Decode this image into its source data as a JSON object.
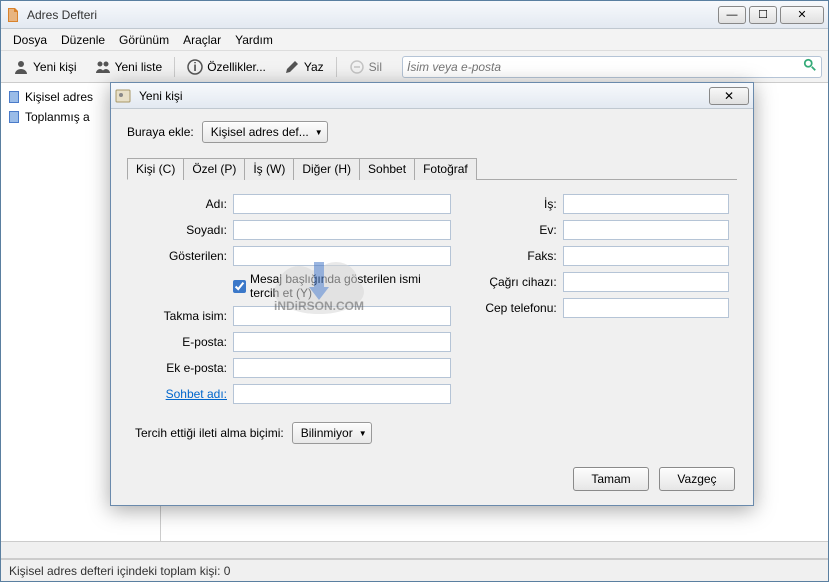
{
  "main": {
    "title": "Adres Defteri",
    "menu": {
      "file": "Dosya",
      "edit": "Düzenle",
      "view": "Görünüm",
      "tools": "Araçlar",
      "help": "Yardım"
    },
    "toolbar": {
      "new_contact": "Yeni kişi",
      "new_list": "Yeni liste",
      "properties": "Özellikler...",
      "write": "Yaz",
      "delete": "Sil",
      "search_placeholder": "İsim veya e-posta"
    },
    "sidebar": {
      "items": [
        {
          "label": "Kişisel adres"
        },
        {
          "label": "Toplanmış a"
        }
      ]
    },
    "status": "Kişisel adres defteri içindeki toplam kişi: 0"
  },
  "dialog": {
    "title": "Yeni kişi",
    "add_to_label": "Buraya ekle:",
    "add_to_value": "Kişisel adres def...",
    "tabs": [
      "Kişi (C)",
      "Özel (P)",
      "İş (W)",
      "Diğer (H)",
      "Sohbet",
      "Fotoğraf"
    ],
    "fields_left": {
      "first": "Adı:",
      "last": "Soyadı:",
      "display": "Gösterilen:",
      "chk": "Mesaj başlığında gösterilen ismi tercih et (Y)",
      "nick": "Takma isim:",
      "email": "E-posta:",
      "email2": "Ek e-posta:",
      "chat": "Sohbet adı:"
    },
    "fields_right": {
      "work": "İş:",
      "home": "Ev:",
      "fax": "Faks:",
      "pager": "Çağrı cihazı:",
      "mobile": "Cep telefonu:"
    },
    "format_label": "Tercih ettiği ileti alma biçimi:",
    "format_value": "Bilinmiyor",
    "ok": "Tamam",
    "cancel": "Vazgeç"
  },
  "watermark": "iNDiRSON.COM"
}
